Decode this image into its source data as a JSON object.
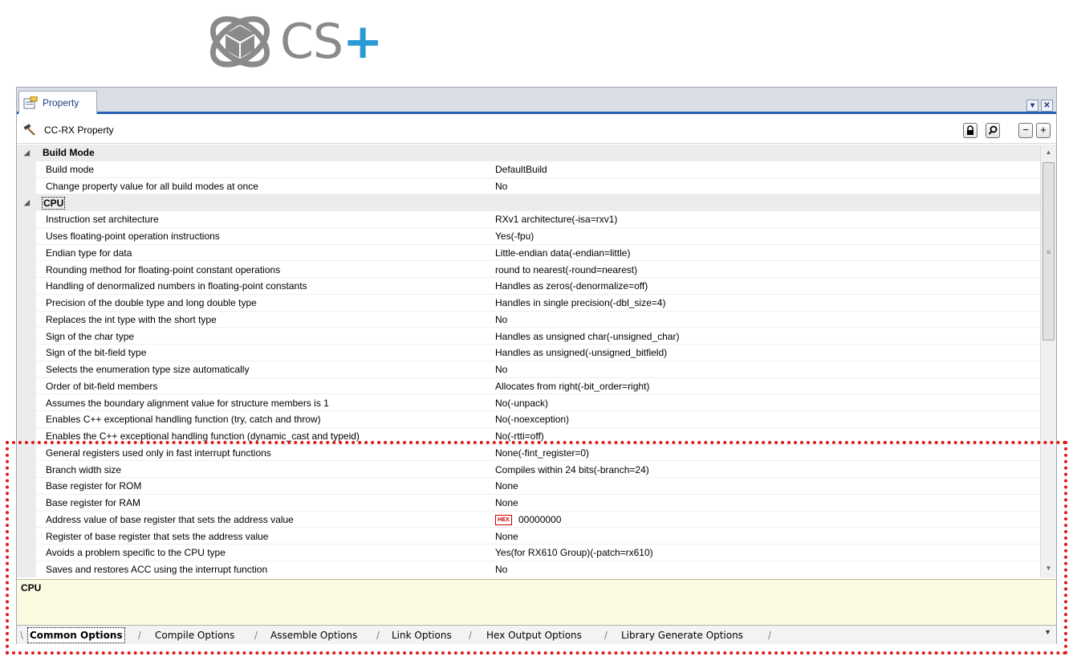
{
  "logo": {
    "text_main": "CS",
    "text_plus": "+"
  },
  "panel": {
    "tab_label": "Property",
    "title": "CC-RX Property"
  },
  "window_controls": {
    "dropdown_glyph": "▾",
    "close_glyph": "✕"
  },
  "toolbar": {
    "lock_glyph": "🔒",
    "search_glyph": "⌕",
    "collapse_glyph": "−",
    "expand_glyph": "+"
  },
  "categories": {
    "build_mode": "Build Mode",
    "cpu": "CPU"
  },
  "rows": {
    "r0": {
      "name": "Build mode",
      "value": "DefaultBuild"
    },
    "r1": {
      "name": "Change property value for all build modes at once",
      "value": "No"
    },
    "r2": {
      "name": "Instruction set architecture",
      "value": "RXv1 architecture(-isa=rxv1)"
    },
    "r3": {
      "name": "Uses floating-point operation instructions",
      "value": "Yes(-fpu)"
    },
    "r4": {
      "name": "Endian type for data",
      "value": "Little-endian data(-endian=little)"
    },
    "r5": {
      "name": "Rounding method for floating-point constant operations",
      "value": "round to nearest(-round=nearest)"
    },
    "r6": {
      "name": "Handling of denormalized numbers in floating-point constants",
      "value": "Handles as zeros(-denormalize=off)"
    },
    "r7": {
      "name": "Precision of the double type and long double type",
      "value": "Handles in single precision(-dbl_size=4)"
    },
    "r8": {
      "name": "Replaces the int type with the short type",
      "value": "No"
    },
    "r9": {
      "name": "Sign of the char type",
      "value": "Handles as unsigned char(-unsigned_char)"
    },
    "r10": {
      "name": "Sign of the bit-field type",
      "value": "Handles as unsigned(-unsigned_bitfield)"
    },
    "r11": {
      "name": "Selects the enumeration type size automatically",
      "value": "No"
    },
    "r12": {
      "name": "Order of bit-field members",
      "value": "Allocates from right(-bit_order=right)"
    },
    "r13": {
      "name": "Assumes the boundary alignment value for structure members is 1",
      "value": "No(-unpack)"
    },
    "r14": {
      "name": "Enables C++ exceptional handling function (try, catch and throw)",
      "value": "No(-noexception)"
    },
    "r15": {
      "name": "Enables the C++ exceptional handling function (dynamic_cast and typeid)",
      "value": "No(-rtti=off)"
    },
    "r16": {
      "name": "General registers used only in fast interrupt functions",
      "value": "None(-fint_register=0)"
    },
    "r17": {
      "name": "Branch width size",
      "value": "Compiles within 24 bits(-branch=24)"
    },
    "r18": {
      "name": "Base register for ROM",
      "value": "None"
    },
    "r19": {
      "name": "Base register for RAM",
      "value": "None"
    },
    "r20": {
      "name": "Address value of base register that sets the address value",
      "value": "00000000",
      "badge": "HEX"
    },
    "r21": {
      "name": "Register of base register that sets the address value",
      "value": "None"
    },
    "r22": {
      "name": "Avoids a problem specific to the CPU type",
      "value": "Yes(for RX610 Group)(-patch=rx610)"
    },
    "r23": {
      "name": "Saves and restores ACC using the interrupt function",
      "value": "No"
    }
  },
  "scrollbar": {
    "up_glyph": "▲",
    "down_glyph": "▼",
    "grip_glyph": "≡"
  },
  "description": {
    "title": "CPU"
  },
  "bottom_tabs": {
    "common": "Common Options",
    "compile": "Compile Options",
    "assemble": "Assemble Options",
    "link": "Link Options",
    "hex": "Hex Output Options",
    "library": "Library Generate Options",
    "menu_glyph": "▼"
  },
  "colors": {
    "accent": "#2b61b5",
    "highlight": "#e01818",
    "description_bg": "#fbfbe1",
    "plus": "#2a9ad6"
  }
}
